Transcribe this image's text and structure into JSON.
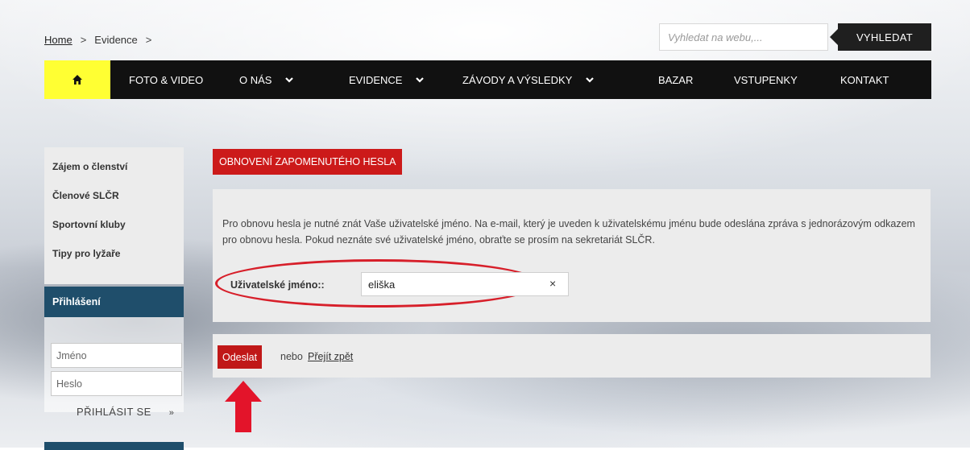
{
  "breadcrumb": {
    "home": "Home",
    "current": "Evidence",
    "sep": ">"
  },
  "search": {
    "placeholder": "Vyhledat na webu,...",
    "button": "VYHLEDAT"
  },
  "nav": {
    "items": [
      {
        "label": "FOTO & VIDEO"
      },
      {
        "label": "O NÁS"
      },
      {
        "label": "EVIDENCE"
      },
      {
        "label": "ZÁVODY A VÝSLEDKY"
      },
      {
        "label": "BAZAR"
      },
      {
        "label": "VSTUPENKY"
      },
      {
        "label": "KONTAKT"
      }
    ]
  },
  "sidebar": {
    "links": [
      {
        "label": "Zájem o členství"
      },
      {
        "label": "Členové SLČR"
      },
      {
        "label": "Sportovní kluby"
      },
      {
        "label": "Tipy pro lyžaře"
      }
    ],
    "login": {
      "title": "Přihlášení",
      "name_placeholder": "Jméno",
      "password_placeholder": "Heslo",
      "submit": "PŘIHLÁSIT SE"
    }
  },
  "main": {
    "title": "OBNOVENÍ ZAPOMENUTÉHO HESLA",
    "description": "Pro obnovu hesla je nutné znát Vaše uživatelské jméno. Na e-mail, který je uveden k uživatelskému jménu bude odeslána zpráva s jednorázovým odkazem pro obnovu hesla. Pokud neznáte své uživatelské jméno, obraťte se prosím na sekretariát SLČR.",
    "field_label": "Uživatelské jméno::",
    "field_value": "eliška",
    "send": "Odeslat",
    "or": "nebo",
    "back": "Přejít zpět"
  },
  "colors": {
    "home_yellow": "#ffff33",
    "nav_black": "#111111",
    "accent_red": "#cc1a1a",
    "sidebar_blue": "#1f4e6b"
  }
}
